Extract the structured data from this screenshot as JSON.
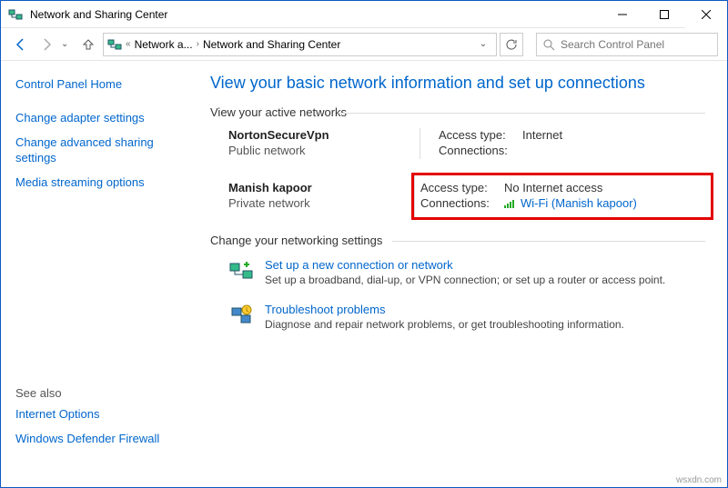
{
  "title": "Network and Sharing Center",
  "breadcrumb": {
    "seg1": "Network a...",
    "seg2": "Network and Sharing Center"
  },
  "search": {
    "placeholder": "Search Control Panel"
  },
  "sidebar": {
    "home": "Control Panel Home",
    "links": [
      "Change adapter settings",
      "Change advanced sharing settings",
      "Media streaming options"
    ],
    "seealso_heading": "See also",
    "seealso": [
      "Internet Options",
      "Windows Defender Firewall"
    ]
  },
  "main": {
    "heading": "View your basic network information and set up connections",
    "active_label": "View your active networks",
    "networks": [
      {
        "name": "NortonSecureVpn",
        "type": "Public network",
        "access_label": "Access type:",
        "access_value": "Internet",
        "conn_label": "Connections:",
        "conn_value": "",
        "highlight": false,
        "wifi_icon": false
      },
      {
        "name": "Manish kapoor",
        "type": "Private network",
        "access_label": "Access type:",
        "access_value": "No Internet access",
        "conn_label": "Connections:",
        "conn_value": "Wi-Fi (Manish kapoor)",
        "highlight": true,
        "wifi_icon": true
      }
    ],
    "change_label": "Change your networking settings",
    "settings": [
      {
        "title": "Set up a new connection or network",
        "desc": "Set up a broadband, dial-up, or VPN connection; or set up a router or access point."
      },
      {
        "title": "Troubleshoot problems",
        "desc": "Diagnose and repair network problems, or get troubleshooting information."
      }
    ]
  },
  "watermark": "wsxdn.com"
}
